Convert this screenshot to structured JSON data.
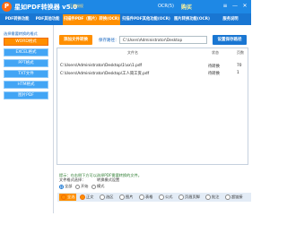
{
  "titlebar": {
    "logo_letter": "P",
    "title": "星如PDF转换器 v5.0",
    "badge": "正版授权",
    "status": "OCR(5)",
    "buy": "购买",
    "menu_icon": "menu-icon",
    "min_icon": "minimize-icon",
    "close_icon": "close-icon"
  },
  "tabs": [
    {
      "label": "PDF转换功能"
    },
    {
      "label": "PDF其他功能"
    },
    {
      "label": "扫描件PDF（图片）转换(OCR)"
    },
    {
      "label": "扫描件PDF其他功能(OCR)"
    },
    {
      "label": "图片转换功能(OCR)"
    },
    {
      "label": "服务说明"
    }
  ],
  "sidebar": {
    "header": "选择需要转换的格式",
    "items": [
      {
        "label": "WORD格式"
      },
      {
        "label": "EXCEL格式"
      },
      {
        "label": "PPT格式"
      },
      {
        "label": "TXT文件"
      },
      {
        "label": "HTM格式"
      },
      {
        "label": "图片PDF"
      }
    ]
  },
  "main": {
    "add_button": "添加文件转换",
    "output_label": "保存路径：",
    "output_value": "C:\\Users\\Administrator\\Desktop",
    "save_button": "设置保存路径",
    "columns": {
      "name": "文件名",
      "status": "状态",
      "pages": "页数"
    },
    "files": [
      {
        "path": "C:\\Users\\Administrator\\Desktop\\1\\xx\\1.pdf",
        "status": "待转换",
        "pages": "70"
      },
      {
        "path": "C:\\Users\\Administrator\\Desktop\\工人简工资.pdf",
        "status": "待转换",
        "pages": "1"
      }
    ],
    "hint": "提示：在右侧下方可以选择PDF需要转换的文件。"
  },
  "bottom": {
    "label": "文件格式选择：",
    "range_label": "转换模式设置",
    "options": [
      {
        "label": "全部"
      },
      {
        "label": "开始"
      },
      {
        "label": "模式"
      }
    ],
    "bar_options": [
      {
        "label": "全选"
      },
      {
        "label": "正文"
      },
      {
        "label": "选区"
      },
      {
        "label": "图片"
      },
      {
        "label": "表格"
      },
      {
        "label": "公式"
      },
      {
        "label": "页眉页脚"
      },
      {
        "label": "批注"
      },
      {
        "label": "超链接"
      }
    ]
  },
  "colors": {
    "primary": "#1976d2",
    "accent": "#ff8f00"
  }
}
